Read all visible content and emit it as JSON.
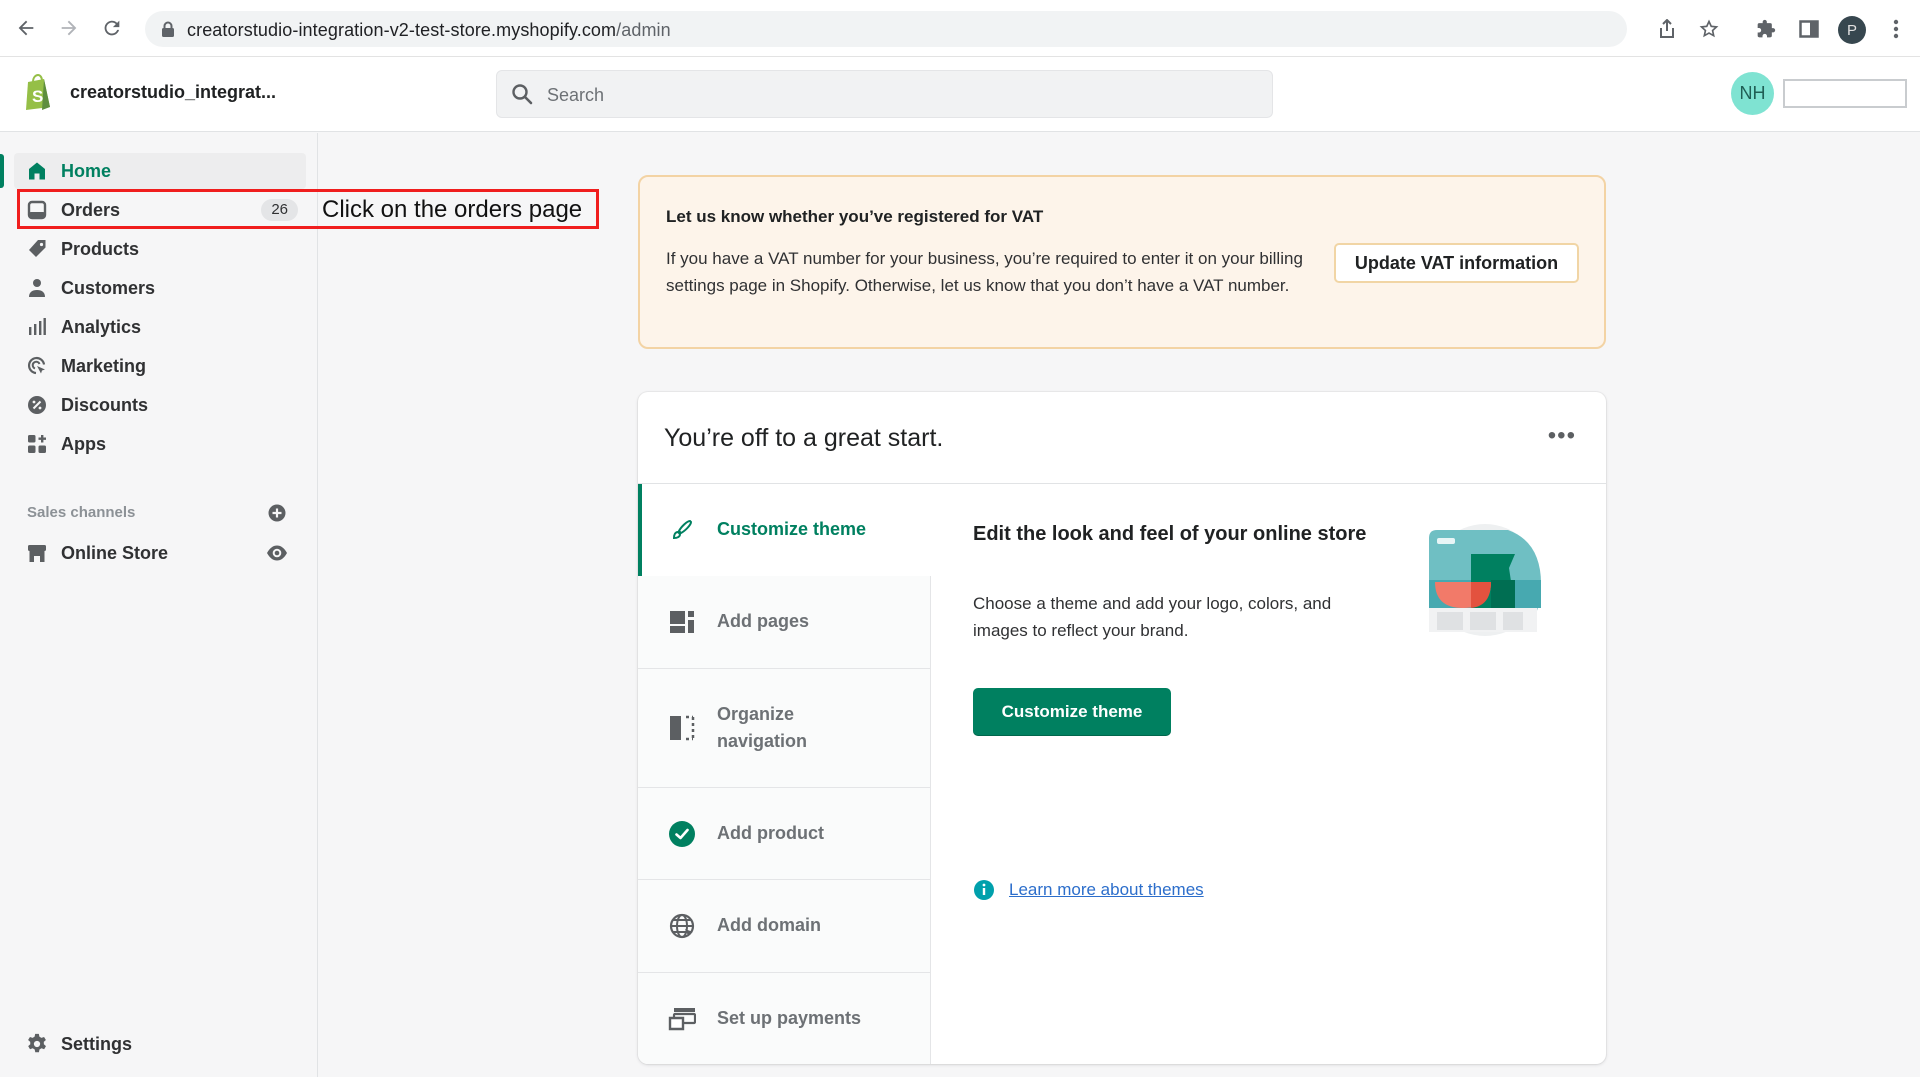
{
  "browser": {
    "url_host": "creatorstudio-integration-v2-test-store.myshopify.com",
    "url_path": "/admin",
    "profile_initial": "P"
  },
  "topbar": {
    "store_name": "creatorstudio_integrat...",
    "search_placeholder": "Search",
    "avatar_initials": "NH"
  },
  "sidebar": {
    "items": [
      {
        "label": "Home",
        "icon": "home-icon",
        "active": true
      },
      {
        "label": "Orders",
        "icon": "orders-icon",
        "badge": "26"
      },
      {
        "label": "Products",
        "icon": "tag-icon"
      },
      {
        "label": "Customers",
        "icon": "person-icon"
      },
      {
        "label": "Analytics",
        "icon": "bar-chart-icon"
      },
      {
        "label": "Marketing",
        "icon": "target-icon"
      },
      {
        "label": "Discounts",
        "icon": "discount-icon"
      },
      {
        "label": "Apps",
        "icon": "apps-icon"
      }
    ],
    "sales_channels_label": "Sales channels",
    "online_store_label": "Online Store",
    "settings_label": "Settings"
  },
  "annotation": {
    "text": "Click on the orders page",
    "color": "#f01e1e"
  },
  "vat_banner": {
    "title": "Let us know whether you’ve registered for VAT",
    "body": "If you have a VAT number for your business, you’re required to enter it on your billing settings page in Shopify. Otherwise, let us know that you don’t have a VAT number.",
    "button_label": "Update VAT information"
  },
  "setup_card": {
    "title": "You’re off to a great start.",
    "more_label": "•••",
    "steps": [
      {
        "label": "Customize theme",
        "icon": "paintbrush-icon",
        "active": true
      },
      {
        "label": "Add pages",
        "icon": "pages-icon"
      },
      {
        "label": "Organize navigation",
        "icon": "navigation-icon"
      },
      {
        "label": "Add product",
        "icon": "check-circle-icon",
        "completed": true
      },
      {
        "label": "Add domain",
        "icon": "globe-icon"
      },
      {
        "label": "Set up payments",
        "icon": "payments-icon"
      }
    ],
    "detail": {
      "title": "Edit the look and feel of your online store",
      "body": "Choose a theme and add your logo, colors, and images to reflect your brand.",
      "button_label": "Customize theme",
      "link_label": "Learn more about themes"
    }
  },
  "colors": {
    "brand_green": "#008060",
    "link_blue": "#2c6ecb",
    "banner_bg": "#fdf4ea",
    "banner_border": "#f3d3a4"
  }
}
